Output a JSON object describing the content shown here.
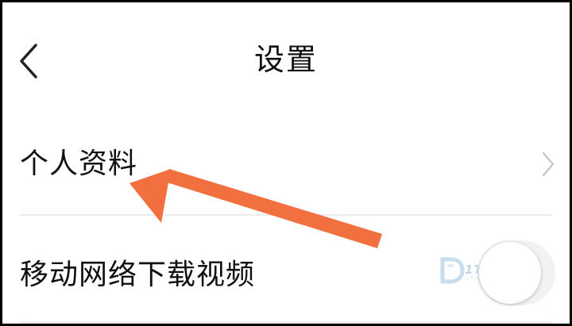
{
  "header": {
    "title": "设置",
    "back_icon": "chevron-left-icon"
  },
  "settings": {
    "items": [
      {
        "label": "个人资料",
        "trailing_icon": "chevron-right-icon"
      },
      {
        "label": "移动网络下载视频",
        "toggle_state": "off"
      }
    ]
  },
  "watermark": {
    "text": "1T5游戏网",
    "subtext": "ITYOU.COM"
  },
  "colors": {
    "annotation_arrow": "#f26f3f",
    "text_primary": "#111111",
    "divider": "#ececec",
    "toggle_track": "#f2f2f2"
  }
}
